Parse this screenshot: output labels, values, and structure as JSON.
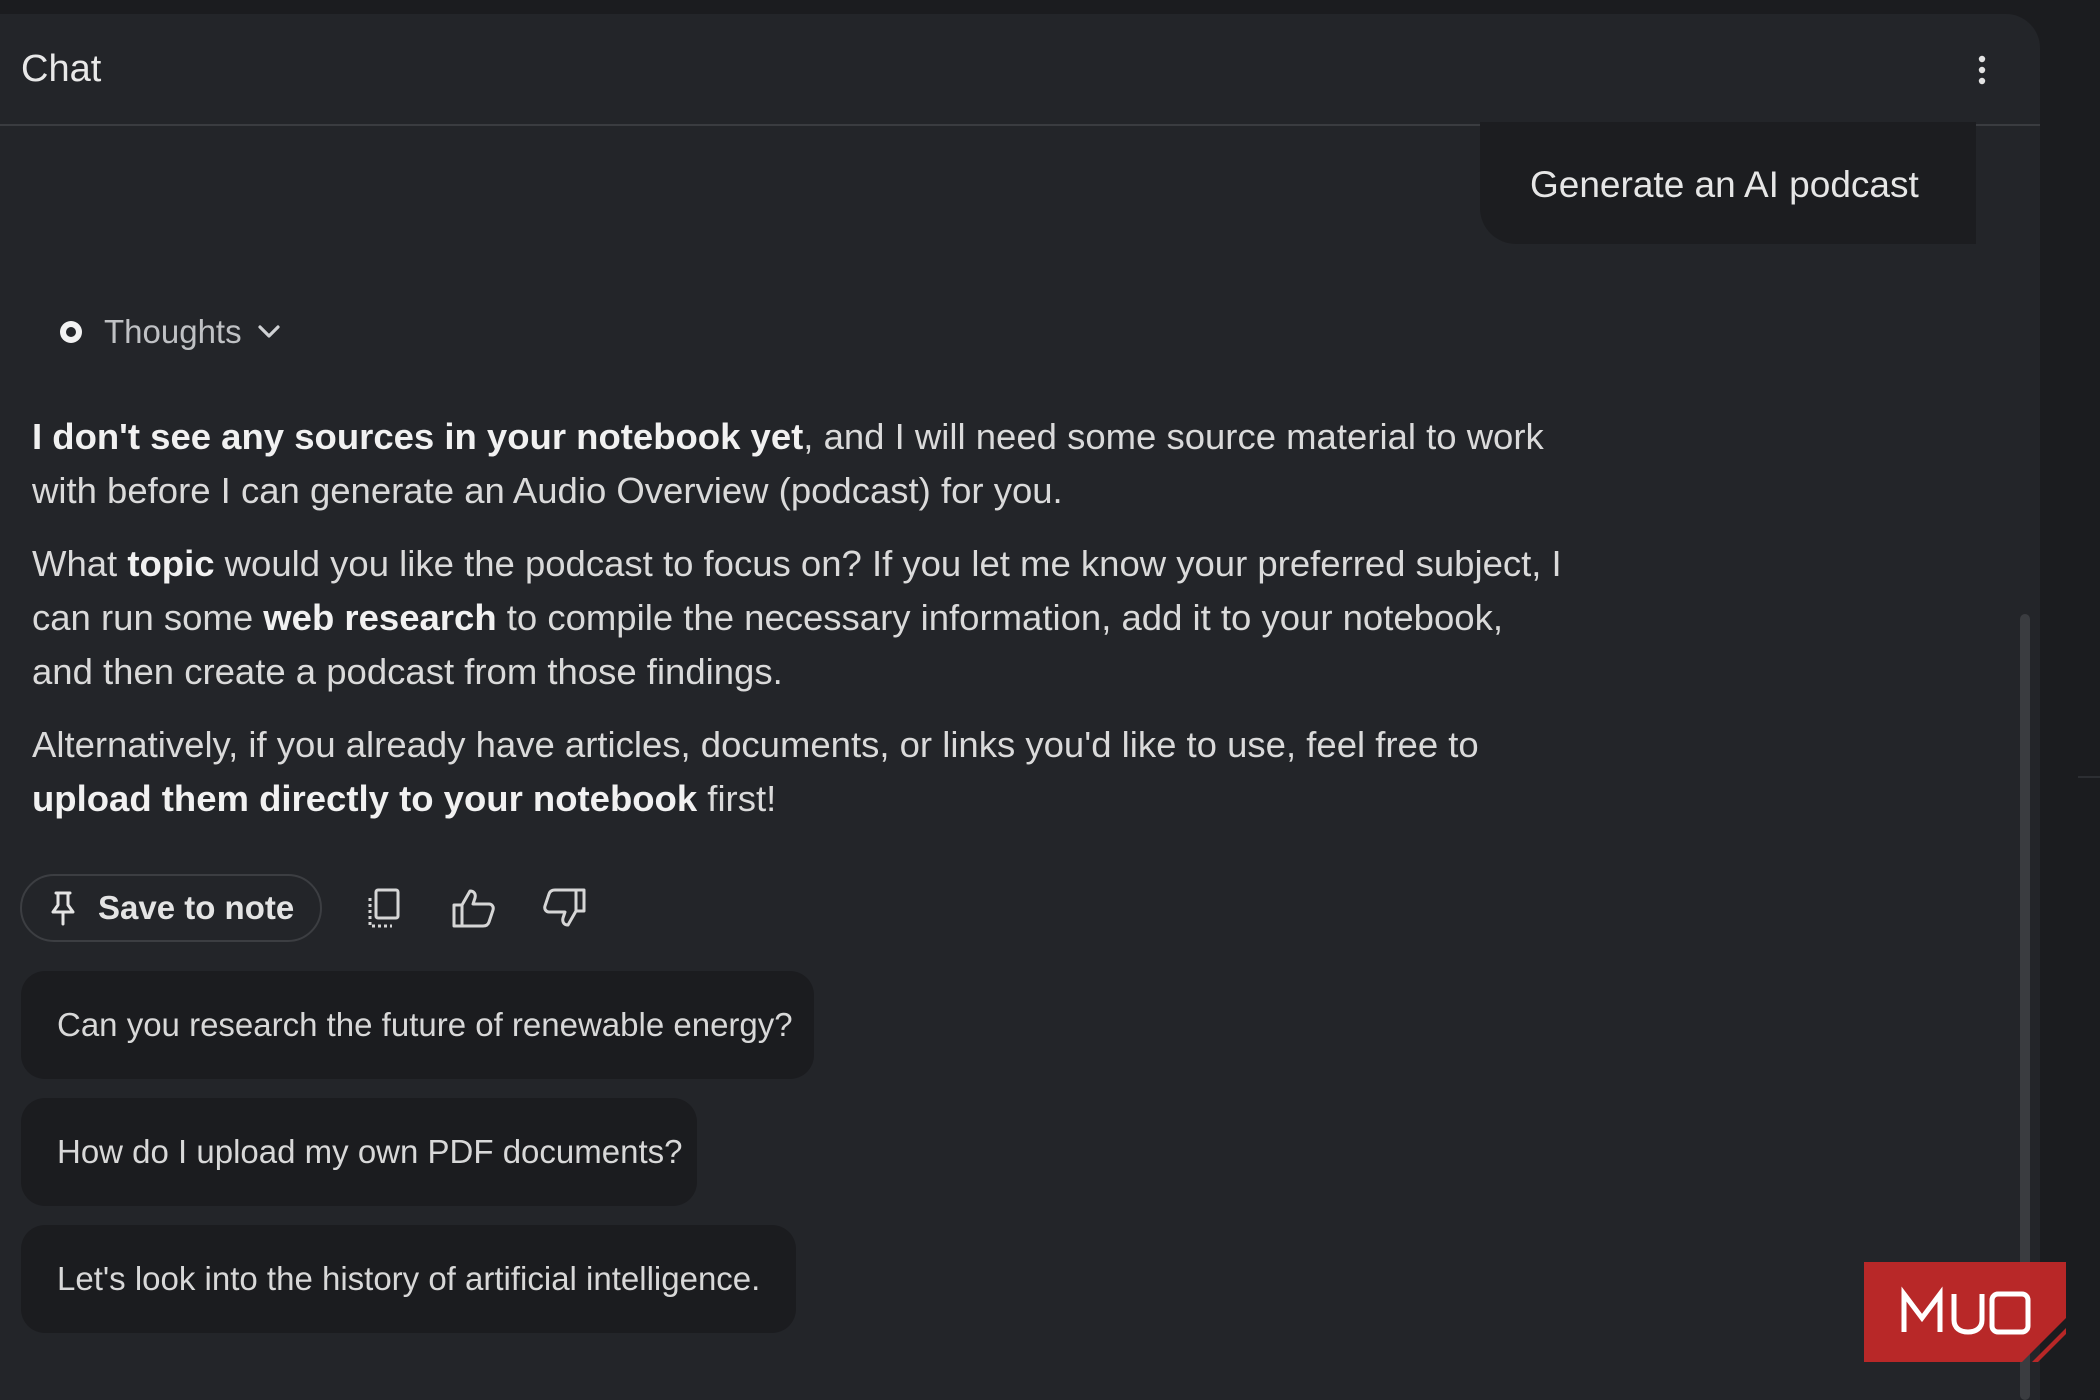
{
  "header": {
    "title": "Chat",
    "menu_icon": "more-vert-icon"
  },
  "user_message": {
    "text": "Generate an AI podcast"
  },
  "thoughts": {
    "label": "Thoughts",
    "expand_icon": "chevron-down-icon"
  },
  "response": {
    "p1_bold": "I don't see any sources in your notebook yet",
    "p1_rest_line1": ", and I will need some source material to work",
    "p1_rest_line2": "with before I can generate an Audio Overview (podcast) for you.",
    "p2_a": "What ",
    "p2_bold1": "topic",
    "p2_b": " would you like the podcast to focus on? If you let me know your preferred subject, I",
    "p2_c": "can run some ",
    "p2_bold2": "web research",
    "p2_d": " to compile the necessary information, add it to your notebook,",
    "p2_e": "and then create a podcast from those findings.",
    "p3_a": "Alternatively, if you already have articles, documents, or links you'd like to use, feel free to",
    "p3_bold": "upload them directly to your notebook",
    "p3_b": " first!"
  },
  "actions": {
    "save_label": "Save to note",
    "save_icon": "pin-icon",
    "copy_icon": "copy-icon",
    "like_icon": "thumbs-up-icon",
    "dislike_icon": "thumbs-down-icon"
  },
  "suggestions": [
    "Can you research the future of renewable energy?",
    "How do I upload my own PDF documents?",
    "Let's look into the history of artificial intelligence."
  ],
  "watermark": {
    "text": "MUO",
    "color": "#c62828"
  },
  "colors": {
    "background": "#1b1c1f",
    "panel": "#232529",
    "bubble": "#1c1d20",
    "text": "#dadada"
  }
}
